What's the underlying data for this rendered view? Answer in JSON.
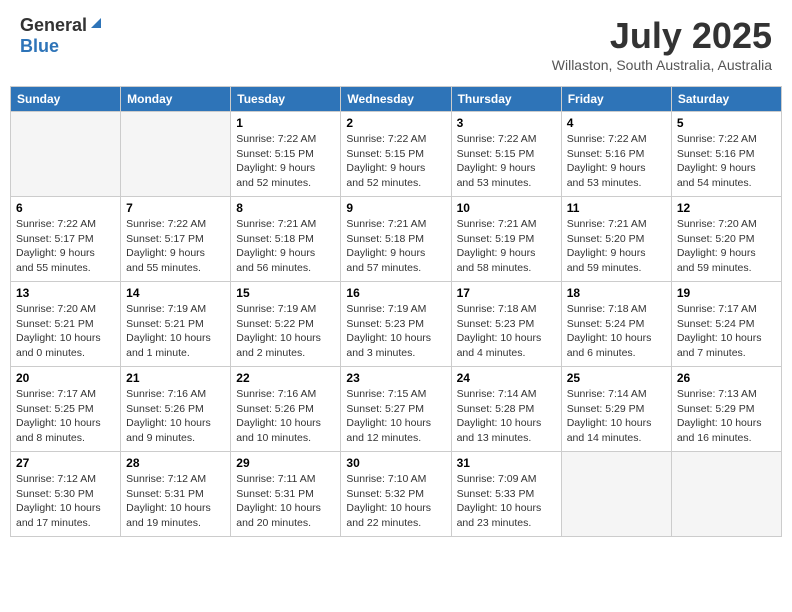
{
  "header": {
    "logo_general": "General",
    "logo_blue": "Blue",
    "month": "July 2025",
    "location": "Willaston, South Australia, Australia"
  },
  "days_of_week": [
    "Sunday",
    "Monday",
    "Tuesday",
    "Wednesday",
    "Thursday",
    "Friday",
    "Saturday"
  ],
  "weeks": [
    [
      {
        "day": "",
        "info": ""
      },
      {
        "day": "",
        "info": ""
      },
      {
        "day": "1",
        "info": "Sunrise: 7:22 AM\nSunset: 5:15 PM\nDaylight: 9 hours\nand 52 minutes."
      },
      {
        "day": "2",
        "info": "Sunrise: 7:22 AM\nSunset: 5:15 PM\nDaylight: 9 hours\nand 52 minutes."
      },
      {
        "day": "3",
        "info": "Sunrise: 7:22 AM\nSunset: 5:15 PM\nDaylight: 9 hours\nand 53 minutes."
      },
      {
        "day": "4",
        "info": "Sunrise: 7:22 AM\nSunset: 5:16 PM\nDaylight: 9 hours\nand 53 minutes."
      },
      {
        "day": "5",
        "info": "Sunrise: 7:22 AM\nSunset: 5:16 PM\nDaylight: 9 hours\nand 54 minutes."
      }
    ],
    [
      {
        "day": "6",
        "info": "Sunrise: 7:22 AM\nSunset: 5:17 PM\nDaylight: 9 hours\nand 55 minutes."
      },
      {
        "day": "7",
        "info": "Sunrise: 7:22 AM\nSunset: 5:17 PM\nDaylight: 9 hours\nand 55 minutes."
      },
      {
        "day": "8",
        "info": "Sunrise: 7:21 AM\nSunset: 5:18 PM\nDaylight: 9 hours\nand 56 minutes."
      },
      {
        "day": "9",
        "info": "Sunrise: 7:21 AM\nSunset: 5:18 PM\nDaylight: 9 hours\nand 57 minutes."
      },
      {
        "day": "10",
        "info": "Sunrise: 7:21 AM\nSunset: 5:19 PM\nDaylight: 9 hours\nand 58 minutes."
      },
      {
        "day": "11",
        "info": "Sunrise: 7:21 AM\nSunset: 5:20 PM\nDaylight: 9 hours\nand 59 minutes."
      },
      {
        "day": "12",
        "info": "Sunrise: 7:20 AM\nSunset: 5:20 PM\nDaylight: 9 hours\nand 59 minutes."
      }
    ],
    [
      {
        "day": "13",
        "info": "Sunrise: 7:20 AM\nSunset: 5:21 PM\nDaylight: 10 hours\nand 0 minutes."
      },
      {
        "day": "14",
        "info": "Sunrise: 7:19 AM\nSunset: 5:21 PM\nDaylight: 10 hours\nand 1 minute."
      },
      {
        "day": "15",
        "info": "Sunrise: 7:19 AM\nSunset: 5:22 PM\nDaylight: 10 hours\nand 2 minutes."
      },
      {
        "day": "16",
        "info": "Sunrise: 7:19 AM\nSunset: 5:23 PM\nDaylight: 10 hours\nand 3 minutes."
      },
      {
        "day": "17",
        "info": "Sunrise: 7:18 AM\nSunset: 5:23 PM\nDaylight: 10 hours\nand 4 minutes."
      },
      {
        "day": "18",
        "info": "Sunrise: 7:18 AM\nSunset: 5:24 PM\nDaylight: 10 hours\nand 6 minutes."
      },
      {
        "day": "19",
        "info": "Sunrise: 7:17 AM\nSunset: 5:24 PM\nDaylight: 10 hours\nand 7 minutes."
      }
    ],
    [
      {
        "day": "20",
        "info": "Sunrise: 7:17 AM\nSunset: 5:25 PM\nDaylight: 10 hours\nand 8 minutes."
      },
      {
        "day": "21",
        "info": "Sunrise: 7:16 AM\nSunset: 5:26 PM\nDaylight: 10 hours\nand 9 minutes."
      },
      {
        "day": "22",
        "info": "Sunrise: 7:16 AM\nSunset: 5:26 PM\nDaylight: 10 hours\nand 10 minutes."
      },
      {
        "day": "23",
        "info": "Sunrise: 7:15 AM\nSunset: 5:27 PM\nDaylight: 10 hours\nand 12 minutes."
      },
      {
        "day": "24",
        "info": "Sunrise: 7:14 AM\nSunset: 5:28 PM\nDaylight: 10 hours\nand 13 minutes."
      },
      {
        "day": "25",
        "info": "Sunrise: 7:14 AM\nSunset: 5:29 PM\nDaylight: 10 hours\nand 14 minutes."
      },
      {
        "day": "26",
        "info": "Sunrise: 7:13 AM\nSunset: 5:29 PM\nDaylight: 10 hours\nand 16 minutes."
      }
    ],
    [
      {
        "day": "27",
        "info": "Sunrise: 7:12 AM\nSunset: 5:30 PM\nDaylight: 10 hours\nand 17 minutes."
      },
      {
        "day": "28",
        "info": "Sunrise: 7:12 AM\nSunset: 5:31 PM\nDaylight: 10 hours\nand 19 minutes."
      },
      {
        "day": "29",
        "info": "Sunrise: 7:11 AM\nSunset: 5:31 PM\nDaylight: 10 hours\nand 20 minutes."
      },
      {
        "day": "30",
        "info": "Sunrise: 7:10 AM\nSunset: 5:32 PM\nDaylight: 10 hours\nand 22 minutes."
      },
      {
        "day": "31",
        "info": "Sunrise: 7:09 AM\nSunset: 5:33 PM\nDaylight: 10 hours\nand 23 minutes."
      },
      {
        "day": "",
        "info": ""
      },
      {
        "day": "",
        "info": ""
      }
    ]
  ]
}
